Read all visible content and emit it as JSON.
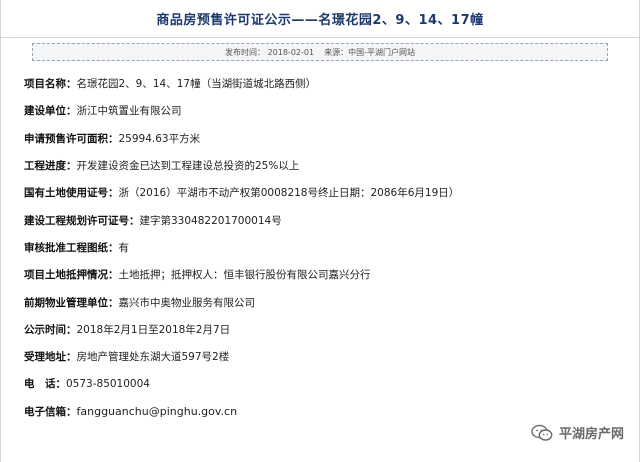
{
  "header": {
    "title": "商品房预售许可证公示——名璟花园2、9、14、17幢"
  },
  "meta": {
    "publish_time": "发布时间： 2018-02-01",
    "source": "来源：中国-平湖门户网站"
  },
  "rows": [
    {
      "label": "项目名称：",
      "value": "名璟花园2、9、14、17幢（当湖街道城北路西侧）"
    },
    {
      "label": "建设单位：",
      "value": "浙江中筑置业有限公司"
    },
    {
      "label": "申请预售许可面积：",
      "value": "25994.63平方米"
    },
    {
      "label": "工程进度：",
      "value": "开发建设资金已达到工程建设总投资的25%以上"
    },
    {
      "label": "国有土地使用证号：",
      "value": "浙（2016）平湖市不动产权第0008218号终止日期：2086年6月19日）"
    },
    {
      "label": "建设工程规划许可证号：",
      "value": "建字第330482201700014号"
    },
    {
      "label": "审核批准工程图纸：",
      "value": "有"
    },
    {
      "label": "项目土地抵押情况：",
      "value": "土地抵押；抵押权人：恒丰银行股份有限公司嘉兴分行"
    },
    {
      "label": "前期物业管理单位：",
      "value": "嘉兴市中奥物业服务有限公司"
    },
    {
      "label": "公示时间：",
      "value": "2018年2月1日至2018年2月7日"
    },
    {
      "label": "受理地址：",
      "value": "房地产管理处东湖大道597号2楼"
    },
    {
      "label": "电　话：",
      "value": "0573-85010004"
    },
    {
      "label": "电子信箱：",
      "value": "fangguanchu@pinghu.gov.cn"
    }
  ],
  "watermark": {
    "text": "平湖房产网",
    "icon": "wechat-icon"
  }
}
